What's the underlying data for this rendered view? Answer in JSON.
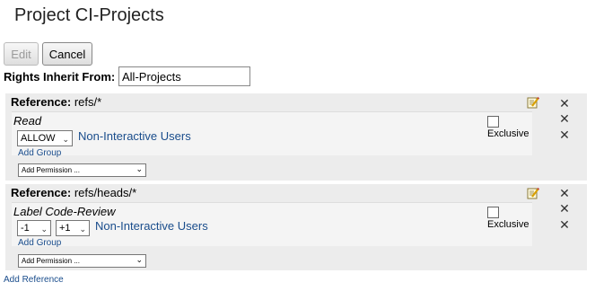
{
  "page": {
    "title": "Project CI-Projects"
  },
  "toolbar": {
    "edit_label": "Edit",
    "cancel_label": "Cancel"
  },
  "inherit": {
    "label": "Rights Inherit From:",
    "value": "All-Projects"
  },
  "references": [
    {
      "label": "Reference:",
      "pattern": "refs/*",
      "permission": {
        "name": "Read",
        "exclusive_label": "Exclusive",
        "rules": [
          {
            "action": "ALLOW",
            "group": "Non-Interactive Users"
          }
        ]
      },
      "add_group": "Add Group",
      "add_permission": "Add Permission ..."
    },
    {
      "label": "Reference:",
      "pattern": "refs/heads/*",
      "permission": {
        "name": "Label Code-Review",
        "exclusive_label": "Exclusive",
        "rules": [
          {
            "min": "-1",
            "max": "+1",
            "group": "Non-Interactive Users"
          }
        ]
      },
      "add_group": "Add Group",
      "add_permission": "Add Permission ..."
    }
  ],
  "footer": {
    "add_reference": "Add Reference"
  },
  "icons": {
    "edit": "edit-pencil-icon",
    "remove": "close-icon",
    "dropdown": "chevron-down-icon"
  }
}
